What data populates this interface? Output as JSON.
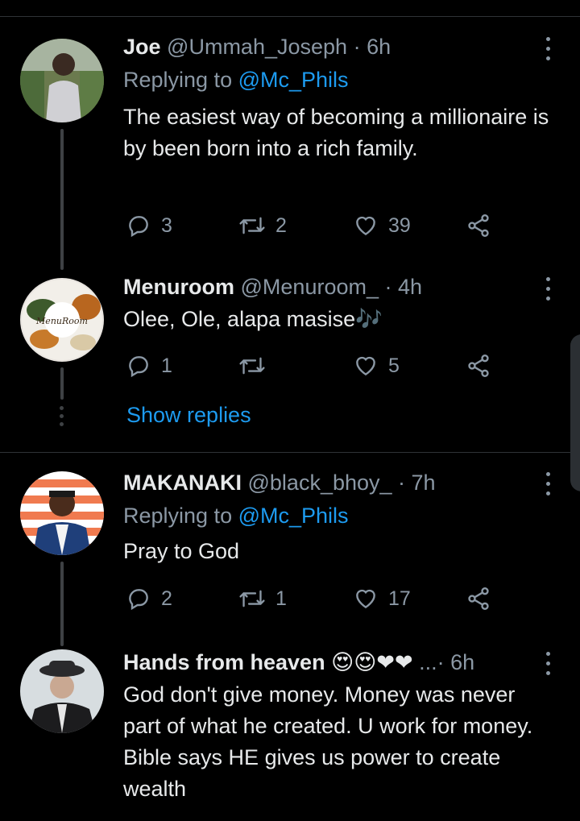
{
  "tweets": [
    {
      "name": "Joe",
      "handle": "@Ummah_Joseph",
      "time": "· 6h",
      "replying_prefix": "Replying to ",
      "replying_to": "@Mc_Phils",
      "text": "The easiest way of becoming a millionaire is by been born into a rich family.",
      "replies": "3",
      "retweets": "2",
      "likes": "39"
    },
    {
      "name": "Menuroom",
      "handle": "@Menuroom_",
      "time": "· 4h",
      "text": "Olee, Ole, alapa masise🎶",
      "replies": "1",
      "retweets": "",
      "likes": "5",
      "avatar_text": "MenuRoom"
    },
    {
      "name": "MAKANAKI",
      "handle": "@black_bhoy_",
      "time": "· 7h",
      "replying_prefix": "Replying to ",
      "replying_to": "@Mc_Phils",
      "text": "Pray to God",
      "replies": "2",
      "retweets": "1",
      "likes": "17"
    },
    {
      "name": "Hands from heaven 😍😍❤❤",
      "handle": "...",
      "time": "· 6h",
      "text": "God don't give money. Money was never part of what he created. U work for money. Bible says HE gives us power to create wealth"
    }
  ],
  "show_replies": "Show replies",
  "colors": {
    "background": "#000000",
    "accent": "#1d9bf0",
    "secondary_text": "#8b98a5",
    "divider": "#2f3336"
  },
  "icons": [
    "reply-icon",
    "retweet-icon",
    "like-icon",
    "share-icon",
    "more-icon"
  ]
}
